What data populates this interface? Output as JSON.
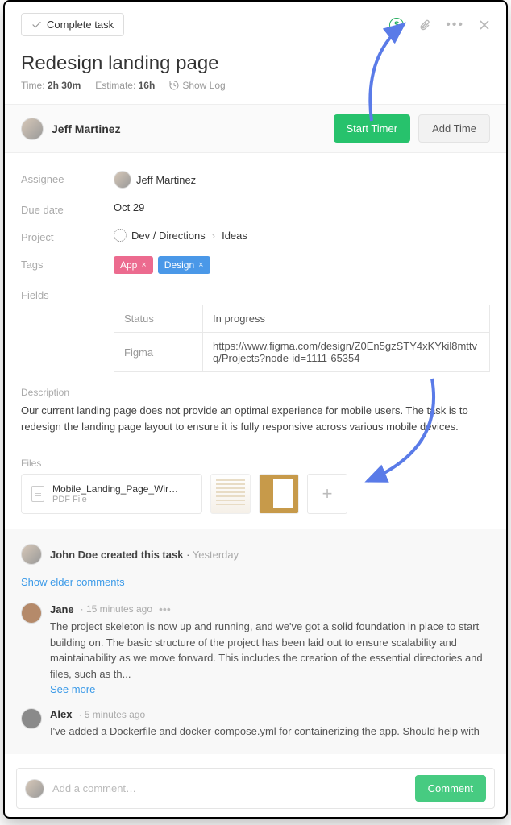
{
  "topbar": {
    "complete_label": "Complete task"
  },
  "task": {
    "title": "Redesign landing page",
    "time_label": "Time:",
    "time_value": "2h 30m",
    "estimate_label": "Estimate:",
    "estimate_value": "16h",
    "show_log": "Show Log"
  },
  "owner": {
    "name": "Jeff Martinez",
    "start_timer": "Start Timer",
    "add_time": "Add Time"
  },
  "details": {
    "assignee_label": "Assignee",
    "assignee_value": "Jeff Martinez",
    "due_label": "Due date",
    "due_value": "Oct 29",
    "project_label": "Project",
    "project_path1": "Dev / Directions",
    "project_path2": "Ideas",
    "tags_label": "Tags",
    "tags": [
      {
        "name": "App",
        "color": "tag-pink"
      },
      {
        "name": "Design",
        "color": "tag-blue"
      }
    ],
    "fields_label": "Fields",
    "fields": [
      {
        "key": "Status",
        "value": "In progress"
      },
      {
        "key": "Figma",
        "value": "https://www.figma.com/design/Z0En5gzSTY4xKYkil8mttvq/Projects?node-id=1111-65354"
      }
    ]
  },
  "description": {
    "label": "Description",
    "text": "Our current landing page does not provide an optimal experience for mobile users. The task is to redesign the landing page layout to ensure it is fully responsive across various mobile devices."
  },
  "files": {
    "label": "Files",
    "file_name": "Mobile_Landing_Page_Wir…",
    "file_type": "PDF File"
  },
  "activity": {
    "creator": "John Doe created this task",
    "creator_time": "Yesterday",
    "elder": "Show elder comments",
    "comments": [
      {
        "author": "Jane",
        "time": "15 minutes ago",
        "text": "The project skeleton is now up and running, and we've got a solid foundation in place to start building on. The basic structure of the project has been laid out to ensure scalability and maintainability as we move forward. This includes the creation of the essential directories and files, such as th...",
        "see_more": "See more",
        "show_dots": true
      },
      {
        "author": "Alex",
        "time": "5 minutes ago",
        "text": "I've added a Dockerfile and docker-compose.yml for containerizing the app. Should help with",
        "see_more": "",
        "show_dots": false
      }
    ]
  },
  "input": {
    "placeholder": "Add a comment…",
    "button": "Comment"
  }
}
